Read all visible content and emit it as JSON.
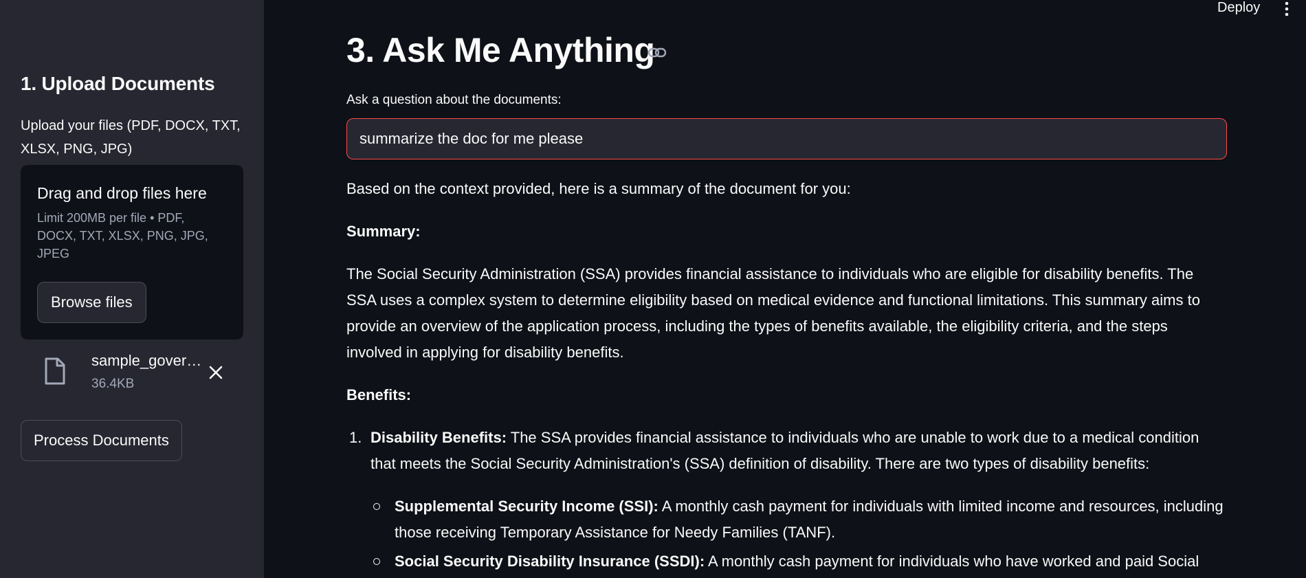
{
  "header": {
    "deploy_label": "Deploy"
  },
  "sidebar": {
    "title": "1. Upload Documents",
    "upload_label": "Upload your files (PDF, DOCX, TXT, XLSX, PNG, JPG)",
    "dropzone_title": "Drag and drop files here",
    "dropzone_hint": "Limit 200MB per file • PDF, DOCX, TXT, XLSX, PNG, JPG, JPEG",
    "browse_label": "Browse files",
    "file": {
      "name": "sample_government_document",
      "size": "36.4KB"
    },
    "process_label": "Process Documents"
  },
  "main": {
    "heading": "3. Ask Me Anything",
    "question_label": "Ask a question about the documents:",
    "question_value": "summarize the doc for me please",
    "answer": {
      "intro": "Based on the context provided, here is a summary of the document for you:",
      "summary_heading": "Summary:",
      "summary_text": "The Social Security Administration (SSA) provides financial assistance to individuals who are eligible for disability benefits. The SSA uses a complex system to determine eligibility based on medical evidence and functional limitations. This summary aims to provide an overview of the application process, including the types of benefits available, the eligibility criteria, and the steps involved in applying for disability benefits.",
      "benefits_heading": "Benefits:",
      "items": [
        {
          "number": "1.",
          "title": "Disability Benefits:",
          "text": " The SSA provides financial assistance to individuals who are unable to work due to a medical condition that meets the Social Security Administration's (SSA) definition of disability. There are two types of disability benefits:",
          "subitems": [
            {
              "title": "Supplemental Security Income (SSI):",
              "text": " A monthly cash payment for individuals with limited income and resources, including those receiving Temporary Assistance for Needy Families (TANF)."
            },
            {
              "title": "Social Security Disability Insurance (SSDI):",
              "text": " A monthly cash payment for individuals who have worked and paid Social"
            }
          ]
        }
      ]
    }
  },
  "colors": {
    "accent": "#ff4b4b",
    "sidebar_bg": "#262730",
    "main_bg": "#0e1117"
  },
  "icons": {
    "file": "file-icon",
    "close": "close-icon",
    "link": "link-icon",
    "menu": "kebab-menu-icon"
  }
}
